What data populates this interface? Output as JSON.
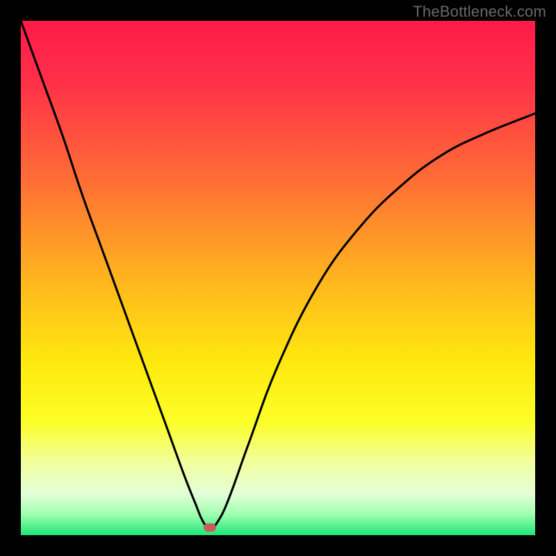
{
  "watermark": "TheBottleneck.com",
  "marker": {
    "color": "#c86058",
    "x_pct": 36.8,
    "y_pct": 98.5
  },
  "chart_data": {
    "type": "line",
    "title": "",
    "xlabel": "",
    "ylabel": "",
    "xlim": [
      0,
      100
    ],
    "ylim": [
      0,
      100
    ],
    "background_gradient_stops": [
      {
        "pct": 0,
        "color": "#ff1a4b"
      },
      {
        "pct": 12,
        "color": "#ff3148"
      },
      {
        "pct": 30,
        "color": "#ff6a36"
      },
      {
        "pct": 50,
        "color": "#ffb41f"
      },
      {
        "pct": 66,
        "color": "#ffe80e"
      },
      {
        "pct": 78,
        "color": "#fbff27"
      },
      {
        "pct": 86,
        "color": "#f1ffa0"
      },
      {
        "pct": 92,
        "color": "#e3ffd8"
      },
      {
        "pct": 96,
        "color": "#9effb0"
      },
      {
        "pct": 100,
        "color": "#1ce678"
      }
    ],
    "series": [
      {
        "name": "bottleneck-curve",
        "x": [
          0,
          4,
          8,
          12,
          16,
          20,
          24,
          28,
          32,
          34,
          35.5,
          36.8,
          38,
          40,
          44,
          50,
          58,
          66,
          74,
          82,
          90,
          100
        ],
        "values": [
          100,
          89,
          78,
          66,
          55,
          44,
          33,
          22,
          11,
          6,
          2.5,
          1.2,
          2.2,
          6,
          17,
          33,
          49,
          60,
          68,
          74,
          78,
          82
        ]
      }
    ],
    "marker_point": {
      "x": 36.8,
      "y": 1.2
    }
  }
}
